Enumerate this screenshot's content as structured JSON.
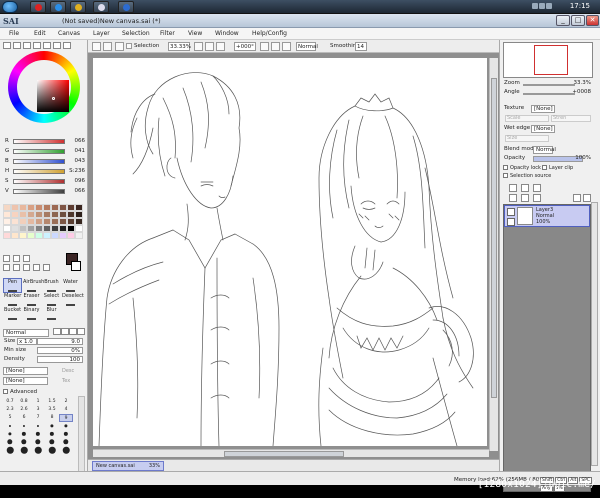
{
  "taskbar": {
    "clock": "17:15",
    "app_icons": [
      "start-orb",
      "opera",
      "ie",
      "chrome",
      "sai",
      "firefox"
    ]
  },
  "window": {
    "logo": "SAI",
    "title": "(Not saved)New canvas.sai (*)",
    "controls": {
      "minimize": "_",
      "maximize": "□",
      "close": "✕"
    }
  },
  "menu": [
    "File",
    "Edit",
    "Canvas",
    "Layer",
    "Selection",
    "Filter",
    "View",
    "Window",
    "Help/Config"
  ],
  "toolbar": {
    "selection_label": "Selection",
    "zoom": "33.33%",
    "angle": "+000°",
    "blend_value": "Normal",
    "smoothing_label": "Smoothing",
    "smoothing_value": "14"
  },
  "colors": {
    "sliders": [
      {
        "label": "R",
        "value": "066",
        "color": "#d03030"
      },
      {
        "label": "G",
        "value": "041",
        "color": "#30a030"
      },
      {
        "label": "B",
        "value": "043",
        "color": "#3050d0"
      },
      {
        "label": "H",
        "value": "S:236",
        "color": "#d0a030"
      },
      {
        "label": "S",
        "value": "096",
        "color": "#b03030"
      },
      {
        "label": "V",
        "value": "066",
        "color": "#404040"
      }
    ],
    "swatches": [
      "#f5d7c4",
      "#eec3ad",
      "#e8b79d",
      "#d9a084",
      "#c98c70",
      "#b47a5f",
      "#9c6852",
      "#7f5444",
      "#5e3c30",
      "#3b2620",
      "#ffe8d8",
      "#f7d3c0",
      "#e9c0a8",
      "#d4a88f",
      "#bf9277",
      "#a67b62",
      "#8c654f",
      "#6e4f3e",
      "#4e372b",
      "#2e201a",
      "#fff0e6",
      "#fbe2d3",
      "#f2cfbb",
      "#e4b9a1",
      "#cfa086",
      "#b5876d",
      "#9a6f58",
      "#7c5745",
      "#5a3f32",
      "#36261f",
      "#ffffff",
      "#e0e0e0",
      "#c0c0c0",
      "#a0a0a0",
      "#808080",
      "#606060",
      "#404040",
      "#202020",
      "#000000",
      "#ffffff",
      "#ffd9d9",
      "#ffe6cc",
      "#fff5cc",
      "#e6ffcc",
      "#ccffe6",
      "#ccf2ff",
      "#ccd9ff",
      "#e6ccff",
      "#ffcce6",
      "#f0f0f0"
    ]
  },
  "tools": [
    {
      "label": "Pen",
      "selected": true
    },
    {
      "label": "AirBrush",
      "selected": false
    },
    {
      "label": "Brush",
      "selected": false
    },
    {
      "label": "Water",
      "selected": false
    },
    {
      "label": "Marker",
      "selected": false
    },
    {
      "label": "Eraser",
      "selected": false
    },
    {
      "label": "Select",
      "selected": false
    },
    {
      "label": "Deselect",
      "selected": false
    },
    {
      "label": "Bucket",
      "selected": false
    },
    {
      "label": "Binary",
      "selected": false
    },
    {
      "label": "Blur",
      "selected": false
    }
  ],
  "brush": {
    "mode": "Normal",
    "size_label": "Size",
    "size_mult": "x 1.0",
    "size_value": "9.0",
    "min_size_label": "Min size",
    "min_size_value": "0%",
    "density_label": "Density",
    "density_value": "100",
    "texture_a": "[None]",
    "texture_a_label": "Desc",
    "texture_b": "[None]",
    "texture_b_label": "Tex",
    "advanced_label": "Advanced"
  },
  "size_presets": [
    {
      "label": "0.7",
      "dot": 0,
      "selected": false
    },
    {
      "label": "0.8",
      "dot": 0,
      "selected": false
    },
    {
      "label": "1",
      "dot": 0,
      "selected": false
    },
    {
      "label": "1.5",
      "dot": 0,
      "selected": false
    },
    {
      "label": "2",
      "dot": 0,
      "selected": false
    },
    {
      "label": "2.3",
      "dot": 0,
      "selected": false
    },
    {
      "label": "2.6",
      "dot": 0,
      "selected": false
    },
    {
      "label": "3",
      "dot": 0,
      "selected": false
    },
    {
      "label": "3.5",
      "dot": 0,
      "selected": false
    },
    {
      "label": "4",
      "dot": 0,
      "selected": false
    },
    {
      "label": "5",
      "dot": 0,
      "selected": false
    },
    {
      "label": "6",
      "dot": 0,
      "selected": false
    },
    {
      "label": "7",
      "dot": 0,
      "selected": false
    },
    {
      "label": "8",
      "dot": 0,
      "selected": false
    },
    {
      "label": "9",
      "dot": 0,
      "selected": true
    },
    {
      "label": "",
      "dot": 1,
      "selected": false
    },
    {
      "label": "",
      "dot": 1,
      "selected": false
    },
    {
      "label": "",
      "dot": 1,
      "selected": false
    },
    {
      "label": "",
      "dot": 2,
      "selected": false
    },
    {
      "label": "",
      "dot": 2,
      "selected": false
    },
    {
      "label": "",
      "dot": 2,
      "selected": false
    },
    {
      "label": "",
      "dot": 3,
      "selected": false
    },
    {
      "label": "",
      "dot": 3,
      "selected": false
    },
    {
      "label": "",
      "dot": 3,
      "selected": false
    },
    {
      "label": "",
      "dot": 3,
      "selected": false
    },
    {
      "label": "",
      "dot": 4,
      "selected": false
    },
    {
      "label": "",
      "dot": 4,
      "selected": false
    },
    {
      "label": "",
      "dot": 4,
      "selected": false
    },
    {
      "label": "",
      "dot": 4,
      "selected": false
    },
    {
      "label": "",
      "dot": 4,
      "selected": false
    },
    {
      "label": "",
      "dot": 5,
      "selected": false
    },
    {
      "label": "",
      "dot": 5,
      "selected": false
    },
    {
      "label": "",
      "dot": 5,
      "selected": false
    },
    {
      "label": "",
      "dot": 5,
      "selected": false
    },
    {
      "label": "",
      "dot": 5,
      "selected": false
    }
  ],
  "navigator": {
    "zoom_label": "Zoom",
    "zoom_value": "33.3%",
    "angle_label": "Angle",
    "angle_value": "+0008"
  },
  "layer_props": {
    "texture_label": "Texture",
    "texture_value": "[None]",
    "scale_label": "Scale",
    "scale_value": "100%",
    "strength_label": "Stren",
    "strength_value": "20",
    "wet_edge_label": "Wet edge",
    "wet_edge_value": "[None]",
    "size_label": "Size",
    "size_value": "100%",
    "blend_mode_label": "Blend mode",
    "blend_mode_value": "Normal",
    "opacity_label": "Opacity",
    "opacity_value": "100%",
    "opacity_level": 100,
    "opacity_lock": "Opacity lock",
    "layer_clip": "Layer clip",
    "selection_source": "Selection source"
  },
  "layers": [
    {
      "name": "Layer3",
      "mode": "Normal",
      "opacity": "100%"
    }
  ],
  "document_tab": {
    "name": "New canvas.sai",
    "zoom": "33%"
  },
  "status": {
    "memory": "Memory load:62% (256MB / 803MB)",
    "keys": [
      "Shift",
      "Ctrl",
      "Alt",
      "SPC",
      "Any",
      "5%"
    ]
  },
  "watermark": "[1280x1024]:upic.me/"
}
